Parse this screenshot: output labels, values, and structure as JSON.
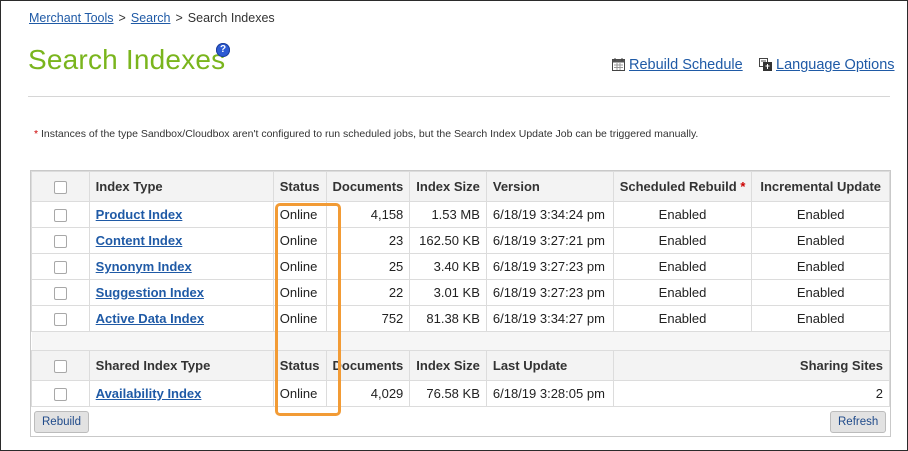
{
  "breadcrumb": {
    "items": [
      "Merchant Tools",
      "Search",
      "Search Indexes"
    ],
    "separator": ">"
  },
  "page": {
    "title": "Search Indexes",
    "help_icon": "?"
  },
  "toplinks": {
    "rebuild_schedule": "Rebuild Schedule",
    "language_options": "Language Options"
  },
  "note": {
    "star": "*",
    "text": " Instances of the type Sandbox/Cloudbox aren't configured to run scheduled jobs, but the Search Index Update Job can be triggered manually."
  },
  "index_table": {
    "headers": [
      "Index Type",
      "Status",
      "Documents",
      "Index Size",
      "Version",
      "Scheduled Rebuild",
      "Incremental Update"
    ],
    "required_star": "*",
    "rows": [
      {
        "name": "Product Index",
        "status": "Online",
        "documents": "4,158",
        "size": "1.53 MB",
        "version": "6/18/19 3:34:24 pm",
        "scheduled": "Enabled",
        "incremental": "Enabled"
      },
      {
        "name": "Content Index",
        "status": "Online",
        "documents": "23",
        "size": "162.50 KB",
        "version": "6/18/19 3:27:21 pm",
        "scheduled": "Enabled",
        "incremental": "Enabled"
      },
      {
        "name": "Synonym Index",
        "status": "Online",
        "documents": "25",
        "size": "3.40 KB",
        "version": "6/18/19 3:27:23 pm",
        "scheduled": "Enabled",
        "incremental": "Enabled"
      },
      {
        "name": "Suggestion Index",
        "status": "Online",
        "documents": "22",
        "size": "3.01 KB",
        "version": "6/18/19 3:27:23 pm",
        "scheduled": "Enabled",
        "incremental": "Enabled"
      },
      {
        "name": "Active Data Index",
        "status": "Online",
        "documents": "752",
        "size": "81.38 KB",
        "version": "6/18/19 3:34:27 pm",
        "scheduled": "Enabled",
        "incremental": "Enabled"
      }
    ]
  },
  "shared_table": {
    "headers": [
      "Shared Index Type",
      "Status",
      "Documents",
      "Index Size",
      "Last Update",
      "Sharing Sites"
    ],
    "rows": [
      {
        "name": "Availability Index",
        "status": "Online",
        "documents": "4,029",
        "size": "76.58 KB",
        "last_update": "6/18/19 3:28:05 pm",
        "sharing_sites": "2"
      }
    ]
  },
  "buttons": {
    "rebuild": "Rebuild",
    "refresh": "Refresh"
  },
  "colors": {
    "title_green": "#7ab51d",
    "link_blue": "#1f5aa6",
    "highlight_orange": "#f29b35"
  }
}
